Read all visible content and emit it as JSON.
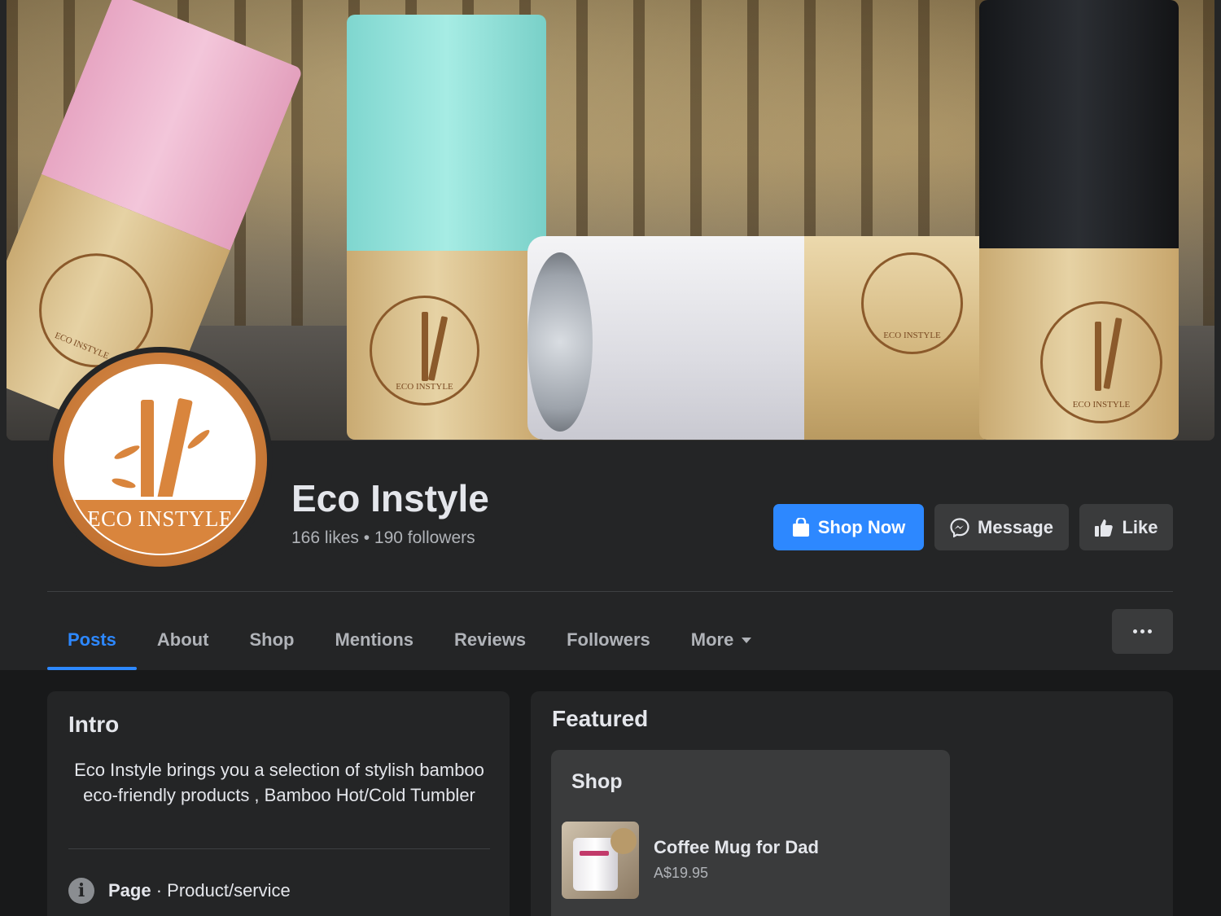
{
  "page": {
    "name": "Eco Instyle",
    "stats": "166 likes • 190 followers",
    "logo_text": "ECO INSTYLE",
    "cover_engraving": "ECO INSTYLE"
  },
  "actions": {
    "shop_now": "Shop Now",
    "message": "Message",
    "like": "Like"
  },
  "tabs": [
    {
      "label": "Posts",
      "active": true
    },
    {
      "label": "About",
      "active": false
    },
    {
      "label": "Shop",
      "active": false
    },
    {
      "label": "Mentions",
      "active": false
    },
    {
      "label": "Reviews",
      "active": false
    },
    {
      "label": "Followers",
      "active": false
    },
    {
      "label": "More",
      "active": false
    }
  ],
  "intro": {
    "title": "Intro",
    "bio": "Eco Instyle brings you a selection of stylish bamboo eco-friendly products , Bamboo Hot/Cold Tumbler",
    "category_prefix": "Page",
    "category": " · Product/service"
  },
  "featured": {
    "title": "Featured",
    "shop_title": "Shop",
    "product": {
      "name": "Coffee Mug for Dad",
      "price": "A$19.95"
    }
  },
  "colors": {
    "accent": "#2d88ff",
    "background": "#18191a",
    "surface": "#242526",
    "button": "#3a3b3c",
    "logo_orange": "#d9853d"
  },
  "icons": {
    "shop_now": "shopping-bag-icon",
    "message": "messenger-icon",
    "like": "thumbs-up-icon",
    "more": "ellipsis-icon",
    "info": "info-icon"
  }
}
